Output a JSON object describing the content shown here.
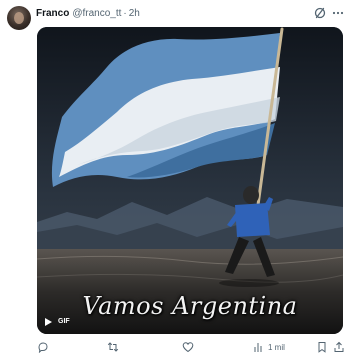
{
  "tweet": {
    "author_name": "Franco",
    "handle": "@franco_tt",
    "separator": "·",
    "time": "2h"
  },
  "media": {
    "caption": "Vamos Argentina",
    "badge": "GIF"
  },
  "actions": {
    "views_count": "1 mil"
  },
  "colors": {
    "text_primary": "#0f1419",
    "text_secondary": "#536471",
    "flag_blue": "#74acdf",
    "flag_white": "#ffffff"
  },
  "icons": [
    "grok-icon",
    "more-icon",
    "play-icon",
    "reply-icon",
    "retweet-icon",
    "like-icon",
    "views-icon",
    "bookmark-icon",
    "share-icon"
  ]
}
